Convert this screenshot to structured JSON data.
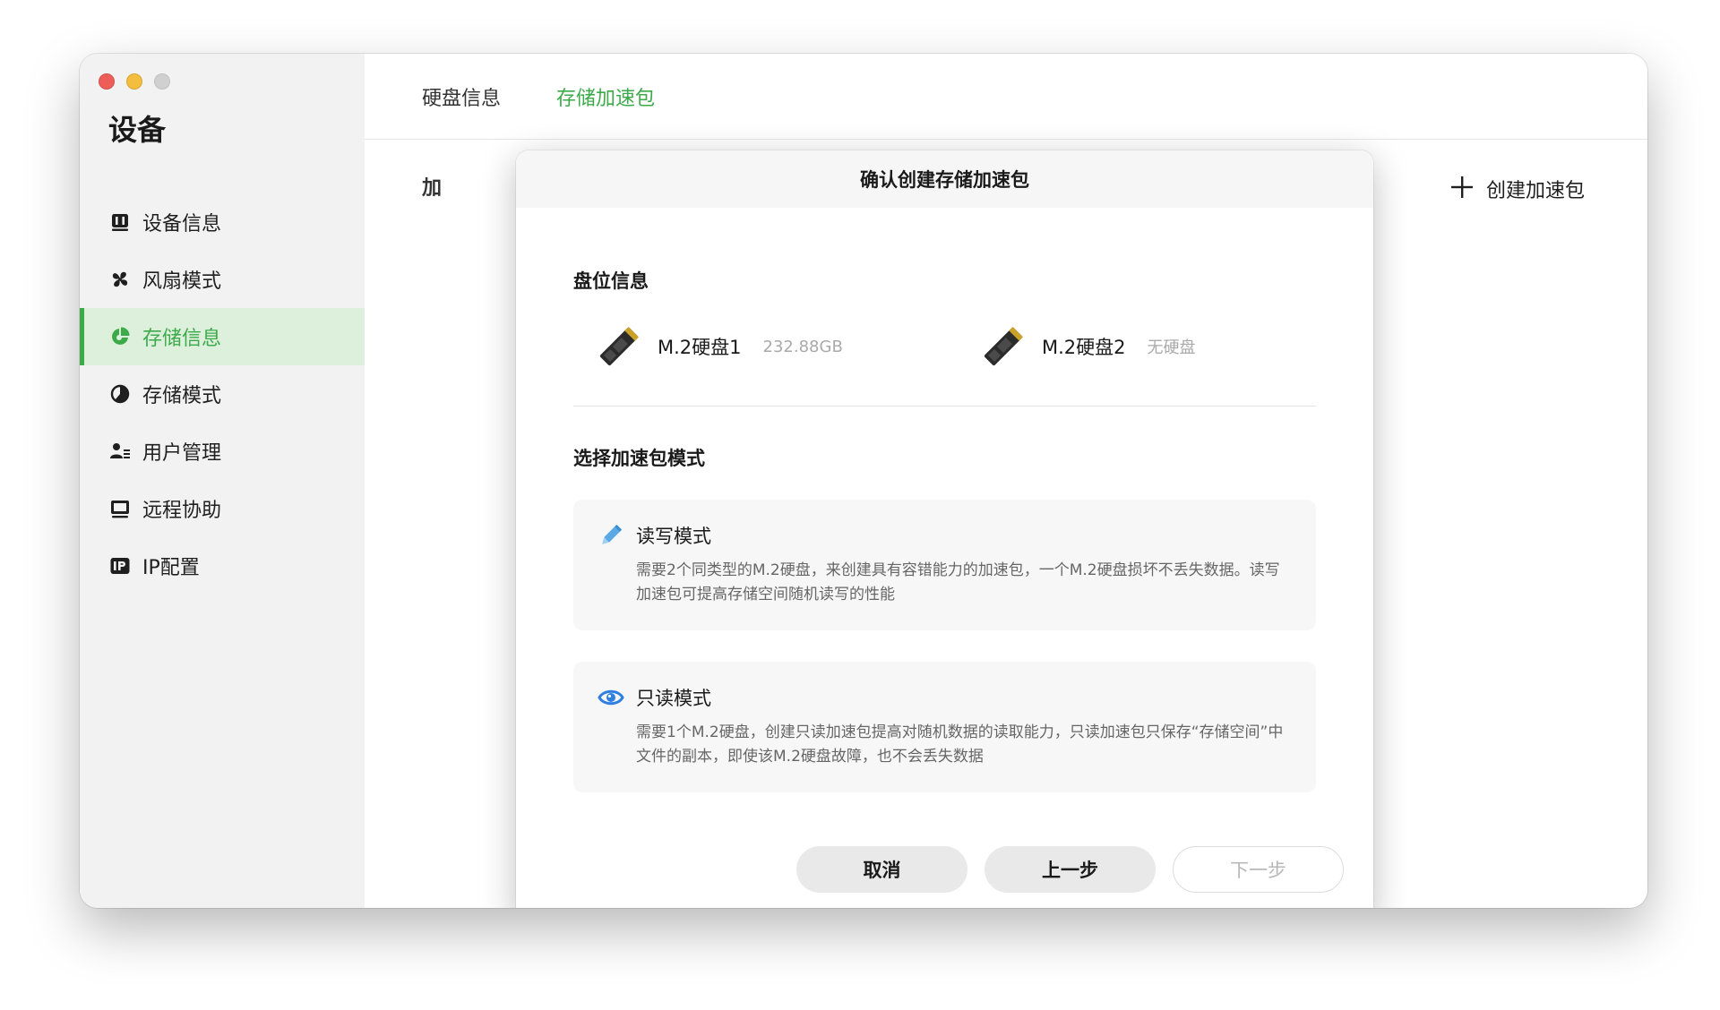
{
  "sidebar": {
    "title": "设备",
    "items": [
      {
        "label": "设备信息",
        "icon": "device-info-icon",
        "active": false
      },
      {
        "label": "风扇模式",
        "icon": "fan-icon",
        "active": false
      },
      {
        "label": "存储信息",
        "icon": "storage-pie-icon",
        "active": true
      },
      {
        "label": "存储模式",
        "icon": "storage-mode-icon",
        "active": false
      },
      {
        "label": "用户管理",
        "icon": "users-icon",
        "active": false
      },
      {
        "label": "远程协助",
        "icon": "remote-monitor-icon",
        "active": false
      },
      {
        "label": "IP配置",
        "icon": "ip-config-icon",
        "active": false
      }
    ]
  },
  "main": {
    "tabs": [
      {
        "label": "硬盘信息",
        "active": false
      },
      {
        "label": "存储加速包",
        "active": true
      }
    ],
    "section_label": "加",
    "create_button_label": "创建加速包"
  },
  "dialog": {
    "title": "确认创建存储加速包",
    "disk_section_title": "盘位信息",
    "disks": [
      {
        "name": "M.2硬盘1",
        "meta": "232.88GB"
      },
      {
        "name": "M.2硬盘2",
        "meta": "无硬盘"
      }
    ],
    "mode_section_title": "选择加速包模式",
    "modes": [
      {
        "name": "读写模式",
        "icon": "pencil-icon",
        "desc": "需要2个同类型的M.2硬盘，来创建具有容错能力的加速包，一个M.2硬盘损坏不丢失数据。读写加速包可提高存储空间随机读写的性能"
      },
      {
        "name": "只读模式",
        "icon": "eye-icon",
        "desc": "需要1个M.2硬盘，创建只读加速包提高对随机数据的读取能力，只读加速包只保存“存储空间”中文件的副本，即使该M.2硬盘故障，也不会丢失数据"
      }
    ],
    "buttons": {
      "cancel": "取消",
      "prev": "上一步",
      "next": "下一步"
    }
  },
  "colors": {
    "accent_green": "#3daa4a",
    "active_bg": "#dcf0dc",
    "close_red": "#ee5e58",
    "min_yellow": "#f3bd3e",
    "eye_blue": "#2f7fe0",
    "pencil_blue": "#5aa9e6"
  }
}
